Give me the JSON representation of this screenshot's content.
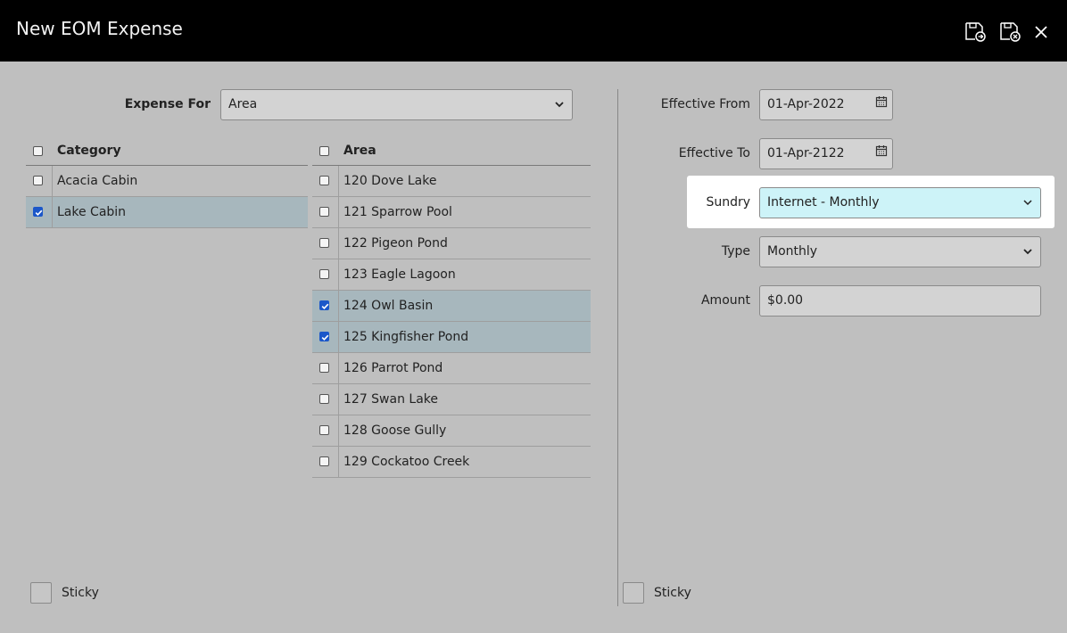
{
  "window": {
    "title": "New EOM Expense",
    "icons": [
      "save-and-new-icon",
      "save-and-close-icon",
      "close-icon"
    ]
  },
  "expense_for": {
    "label": "Expense For",
    "value": "Area"
  },
  "category_list": {
    "header": "Category",
    "rows": [
      {
        "label": "Acacia Cabin",
        "checked": false
      },
      {
        "label": "Lake Cabin",
        "checked": true
      }
    ]
  },
  "area_list": {
    "header": "Area",
    "rows": [
      {
        "label": "120 Dove Lake",
        "checked": false
      },
      {
        "label": "121 Sparrow Pool",
        "checked": false
      },
      {
        "label": "122 Pigeon Pond",
        "checked": false
      },
      {
        "label": "123 Eagle Lagoon",
        "checked": false
      },
      {
        "label": "124 Owl Basin",
        "checked": true
      },
      {
        "label": "125 Kingfisher Pond",
        "checked": true
      },
      {
        "label": "126 Parrot Pond",
        "checked": false
      },
      {
        "label": "127 Swan Lake",
        "checked": false
      },
      {
        "label": "128 Goose Gully",
        "checked": false
      },
      {
        "label": "129 Cockatoo Creek",
        "checked": false
      }
    ]
  },
  "form": {
    "effective_from": {
      "label": "Effective From",
      "value": "01-Apr-2022"
    },
    "effective_to": {
      "label": "Effective To",
      "value": "01-Apr-2122"
    },
    "sundry": {
      "label": "Sundry",
      "value": "Internet - Monthly"
    },
    "type": {
      "label": "Type",
      "value": "Monthly"
    },
    "amount": {
      "label": "Amount",
      "value": "$0.00"
    }
  },
  "sticky_left": {
    "label": "Sticky",
    "checked": false
  },
  "sticky_right": {
    "label": "Sticky",
    "checked": false
  },
  "colors": {
    "titlebar": "#000000",
    "background": "#bfbfbf",
    "selected_row": "#a7b7bd",
    "highlight": "#ffffff",
    "sundry_field": "#cdf3f8",
    "checkbox_checked": "#1b57c9"
  }
}
